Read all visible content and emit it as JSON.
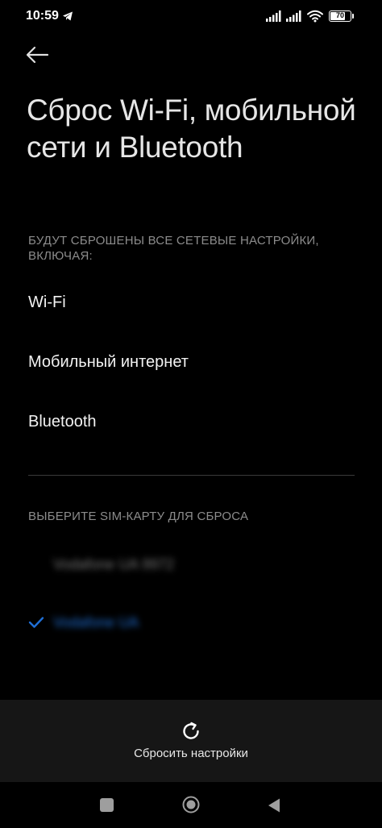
{
  "status_bar": {
    "time": "10:59",
    "battery": "70",
    "battery_level": 0.7,
    "icons": [
      "telegram-icon",
      "signal-icon",
      "signal-icon",
      "wifi-icon",
      "battery-icon"
    ]
  },
  "header": {
    "back_icon": "back-arrow-icon",
    "title": "Сброс Wi-Fi, мобильной сети и Bluetooth"
  },
  "reset_info": {
    "label": "БУДУТ СБРОШЕНЫ ВСЕ СЕТЕВЫЕ НАСТРОЙКИ, ВКЛЮЧАЯ:",
    "items": [
      {
        "label": "Wi-Fi"
      },
      {
        "label": "Мобильный интернет"
      },
      {
        "label": "Bluetooth"
      }
    ]
  },
  "sim_section": {
    "label": "ВЫБЕРИТЕ SIM-КАРТУ ДЛЯ СБРОСА",
    "options": [
      {
        "label": "Vodafone UA 9972",
        "selected": false
      },
      {
        "label": "Vodafone UA",
        "selected": true
      }
    ],
    "selected_color": "#1f6fd6"
  },
  "action": {
    "icon": "reset-icon",
    "label": "Сбросить настройки"
  },
  "nav_bar": {
    "icons": [
      "recents-icon",
      "home-icon",
      "back-icon"
    ]
  }
}
